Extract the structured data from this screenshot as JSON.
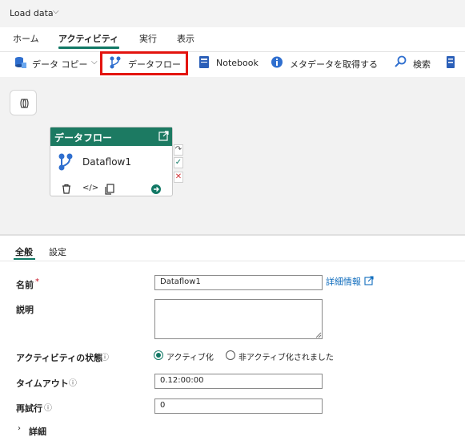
{
  "titlebar": {
    "title": "Load data"
  },
  "tabs": [
    {
      "label": "ホーム"
    },
    {
      "label": "アクティビティ"
    },
    {
      "label": "実行"
    },
    {
      "label": "表示"
    }
  ],
  "toolbar": {
    "copy": "データ コピー",
    "dataflow": "データフロー",
    "notebook": "Notebook",
    "metadata": "メタデータを取得する",
    "search": "検索"
  },
  "activity_card": {
    "header": "データフロー",
    "name": "Dataflow1"
  },
  "properties": {
    "tabs": [
      "全般",
      "設定"
    ],
    "name_label": "名前",
    "required_mark": "*",
    "name_value": "Dataflow1",
    "more_info": "詳細情報",
    "desc_label": "説明",
    "state_label": "アクティビティの状態",
    "state_active": "アクティブ化",
    "state_inactive": "非アクティブ化されました",
    "timeout_label": "タイムアウト",
    "timeout_value": "0.12:00:00",
    "retry_label": "再試行",
    "retry_value": "0",
    "details": "詳細"
  },
  "colors": {
    "accent": "#117865",
    "card_header": "#1c7a62",
    "highlight": "#e3140f",
    "link": "#0f6cbd"
  }
}
